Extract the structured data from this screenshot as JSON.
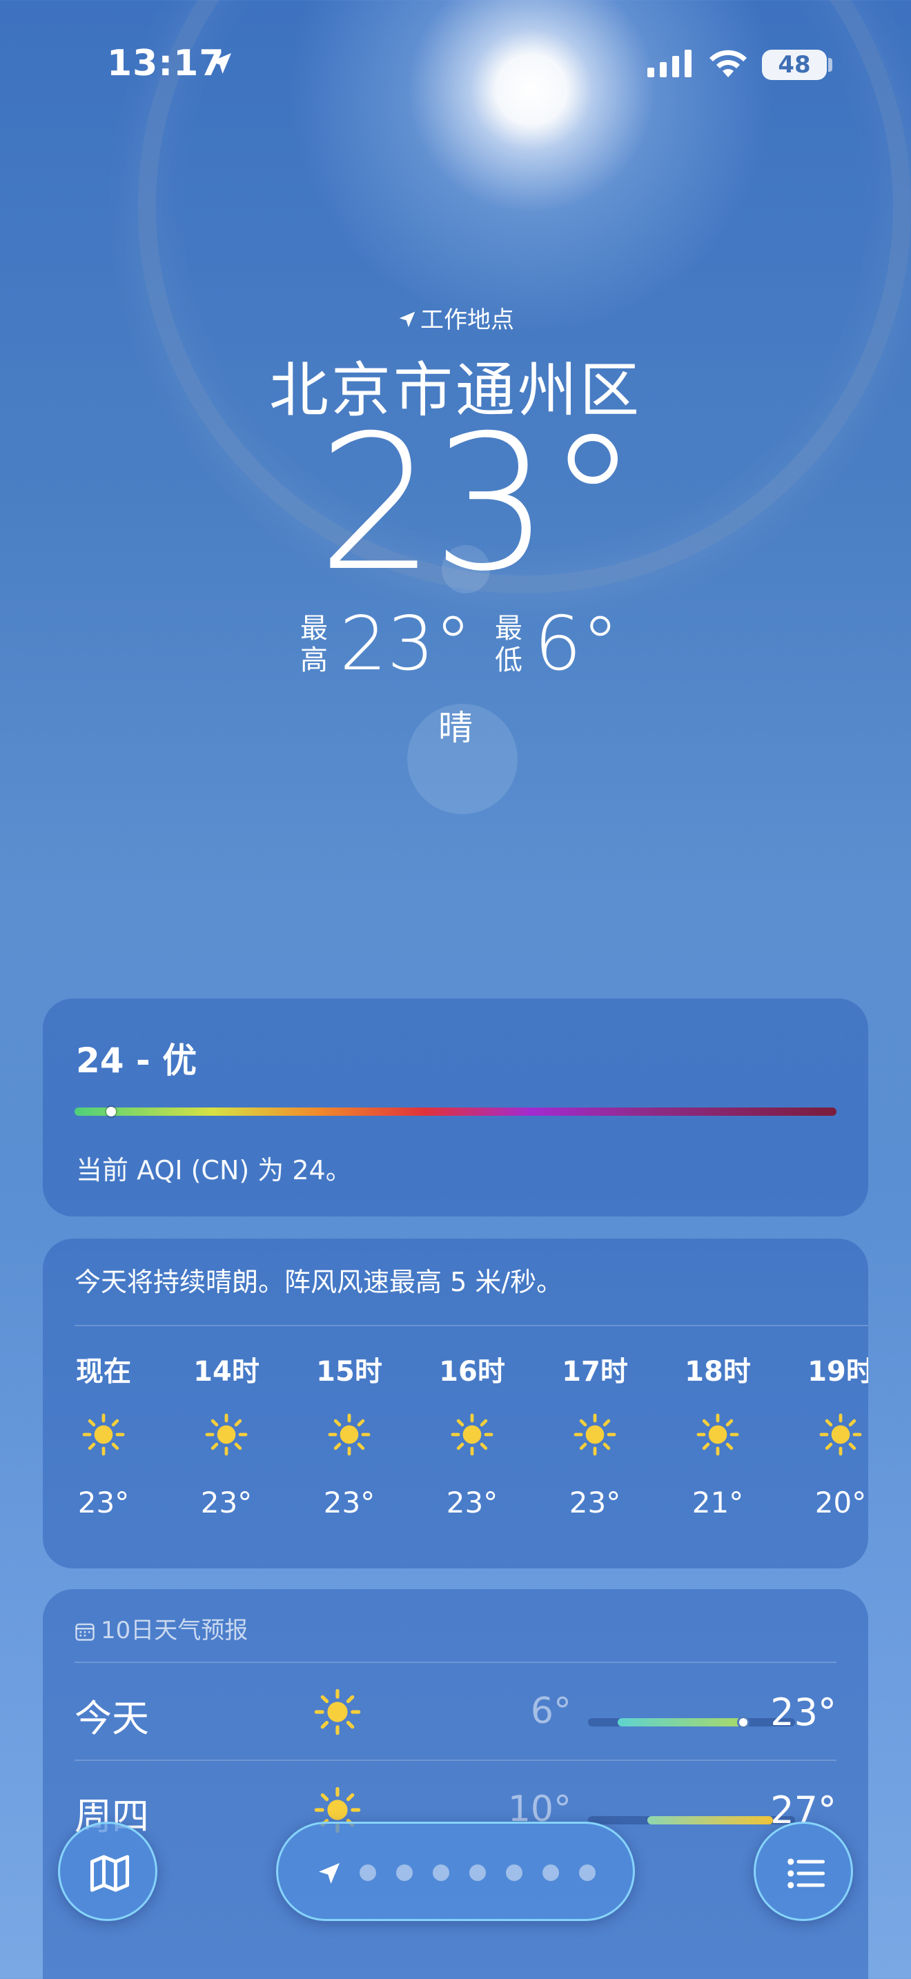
{
  "status_bar": {
    "time": "13:17",
    "battery": "48"
  },
  "header": {
    "location_label": "工作地点",
    "city": "北京市通州区",
    "temperature": "23°",
    "high_tag": "最高",
    "high": "23°",
    "low_tag": "最低",
    "low": "6°",
    "condition": "晴"
  },
  "aqi": {
    "title": "24 - 优",
    "value": 24,
    "scale_max": 500,
    "description": "当前 AQI (CN) 为 24。"
  },
  "hourly": {
    "summary": "今天将持续晴朗。阵风风速最高 5 米/秒。",
    "items": [
      {
        "label": "现在",
        "icon": "sun-icon",
        "temp": "23°"
      },
      {
        "label": "14时",
        "icon": "sun-icon",
        "temp": "23°"
      },
      {
        "label": "15时",
        "icon": "sun-icon",
        "temp": "23°"
      },
      {
        "label": "16时",
        "icon": "sun-icon",
        "temp": "23°"
      },
      {
        "label": "17时",
        "icon": "sun-icon",
        "temp": "23°"
      },
      {
        "label": "18时",
        "icon": "sun-icon",
        "temp": "21°"
      },
      {
        "label": "19时",
        "icon": "sun-icon",
        "temp": "20°"
      }
    ]
  },
  "daily": {
    "title": "10日天气预报",
    "days": [
      {
        "name": "今天",
        "icon": "sun-icon",
        "low": "6°",
        "high": "23°",
        "low_val": 6,
        "high_val": 23,
        "current_val": 23,
        "bar_colors": [
          "#5fd3cf",
          "#a7d86a"
        ]
      },
      {
        "name": "周四",
        "icon": "sun-icon",
        "low": "10°",
        "high": "27°",
        "low_val": 10,
        "high_val": 27,
        "bar_colors": [
          "#8fd6b0",
          "#f0c43a"
        ]
      }
    ],
    "range_min": 2,
    "range_max": 30
  },
  "toolbar": {
    "map_icon": "map-icon",
    "list_icon": "list-icon",
    "page_count": 7
  },
  "colors": {
    "sun": "#f7cf3c"
  }
}
